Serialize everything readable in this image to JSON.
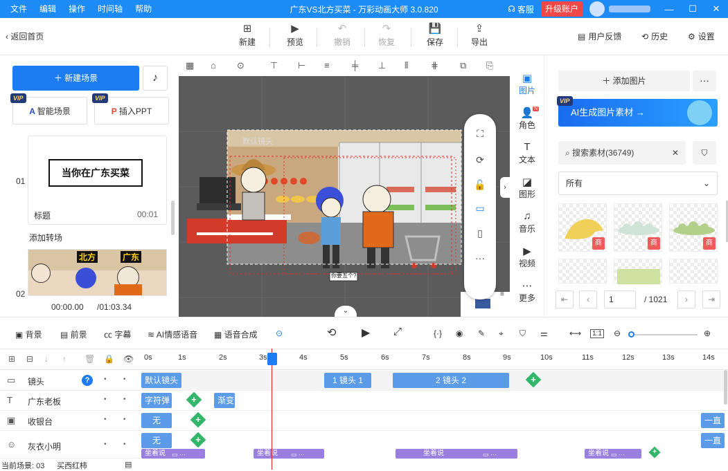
{
  "titlebar": {
    "menu": [
      "文件",
      "编辑",
      "操作",
      "时间轴",
      "帮助"
    ],
    "title": "广东VS北方买菜 - 万彩动画大师 3.0.820",
    "service": "客服",
    "upgrade": "升级账户",
    "colors": {
      "bar": "#1d8bf5",
      "upgrade": "#f04848"
    }
  },
  "toolbar": {
    "back": "返回首页",
    "buttons": [
      {
        "label": "新建",
        "icon": "plus-square-icon"
      },
      {
        "label": "预览",
        "icon": "play-icon"
      },
      {
        "label": "撤销",
        "icon": "undo-icon",
        "disabled": true
      },
      {
        "label": "恢复",
        "icon": "redo-icon",
        "disabled": true
      },
      {
        "label": "保存",
        "icon": "save-icon"
      },
      {
        "label": "导出",
        "icon": "export-icon"
      }
    ],
    "right": [
      "用户反馈",
      "历史",
      "设置"
    ]
  },
  "left": {
    "new_scene": "新建场景",
    "smart_scene": "智能场景",
    "insert_ppt": "插入PPT",
    "vip": "VIP",
    "scene1": {
      "index": "01",
      "caption": "当你在广东买菜",
      "title": "标题",
      "duration": "00:01"
    },
    "add_transition": "添加转场",
    "scene2": {
      "index": "02",
      "tag_north": "北方",
      "tag_gd": "广东"
    },
    "time_current": "00:00.00",
    "time_total": "/01:03.34"
  },
  "stage": {
    "default_camera": "默认镜头",
    "bubble": "你要五个?"
  },
  "vtabs": [
    {
      "label": "图片",
      "icon": "image-icon",
      "active": true
    },
    {
      "label": "角色",
      "icon": "person-icon"
    },
    {
      "label": "文本",
      "icon": "text-icon"
    },
    {
      "label": "图形",
      "icon": "shape-icon"
    },
    {
      "label": "音乐",
      "icon": "music-icon"
    },
    {
      "label": "视频",
      "icon": "video-icon"
    },
    {
      "label": "更多",
      "icon": "more-icon"
    }
  ],
  "assets": {
    "add_image": "添加图片",
    "ai_banner": "AI生成图片素材 →",
    "search_placeholder": "搜索素材(36749)",
    "category": "所有",
    "badge": "商",
    "page": "1",
    "total_pages": "/ 1021"
  },
  "timeline": {
    "tools": [
      "背景",
      "前景",
      "字幕",
      "AI情感语音",
      "语音合成"
    ],
    "ruler": [
      "0s",
      "1s",
      "2s",
      "3s",
      "4s",
      "5s",
      "6s",
      "7s",
      "8s",
      "9s",
      "10s",
      "11s",
      "12s",
      "13s",
      "14s"
    ],
    "tracks": [
      {
        "name": "镜头",
        "clips": [
          {
            "label": "默认镜头"
          },
          {
            "label": "1 镜头 1"
          },
          {
            "label": "2 镜头 2"
          }
        ]
      },
      {
        "name": "广东老板",
        "clips": [
          {
            "label": "字符弹"
          },
          {
            "label": "渐变"
          }
        ]
      },
      {
        "name": "收银台",
        "clips": [
          {
            "label": "无"
          },
          {
            "label": "一直"
          }
        ]
      },
      {
        "name": "灰衣小明",
        "clips": [
          {
            "label": "无"
          },
          {
            "label": "一直"
          }
        ]
      }
    ],
    "speech_label": "坐着说",
    "status_scene": "当前场景: 03",
    "status_item": "买西红柿",
    "ratio": "1:1"
  }
}
